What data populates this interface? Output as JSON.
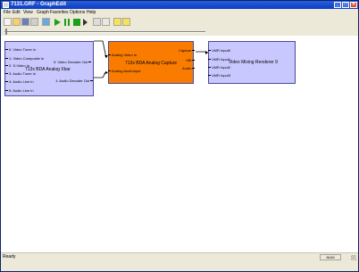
{
  "window": {
    "title": "7131.GRF - GraphEdit",
    "minimize": "_",
    "maximize": "□",
    "close": "✕"
  },
  "menu": [
    "File",
    "Edit",
    "View",
    "Graph",
    "Favorites",
    "Options",
    "Help"
  ],
  "toolbar": {
    "buttons": [
      "new-icon",
      "open-icon",
      "save-icon",
      "print-icon",
      "add-filter-icon",
      "play-icon",
      "pause-icon",
      "stop-icon",
      "frame-step-icon",
      "seek-icon",
      "refresh-icon",
      "help-icon",
      "about-icon"
    ],
    "play_color": "#1aa01a"
  },
  "graph": {
    "xbar": {
      "name": "713x BDA Analog Xbar",
      "inputs": [
        "0: Video Tuner In",
        "1: Video Composite In",
        "2: S-Video In",
        "3: Audio Tuner In",
        "4: Audio Line In",
        "5: Audio Line In"
      ],
      "outputs": [
        "0: Video Decoder Out",
        "1: Audio Decoder Out"
      ]
    },
    "capture": {
      "name": "713x BDA Analog Capture",
      "inputs": [
        "Analog Video In",
        "Analog AudioInput"
      ],
      "outputs": [
        "Capture",
        "VBI",
        "Audio"
      ],
      "color": "#f97c00"
    },
    "vmr": {
      "name": "Video Mixing Renderer 9",
      "inputs": [
        "VMR Input0",
        "VMR Input1",
        "VMR Input2",
        "VMR Input3"
      ]
    }
  },
  "status": {
    "text": "Ready",
    "num": "NUM"
  }
}
